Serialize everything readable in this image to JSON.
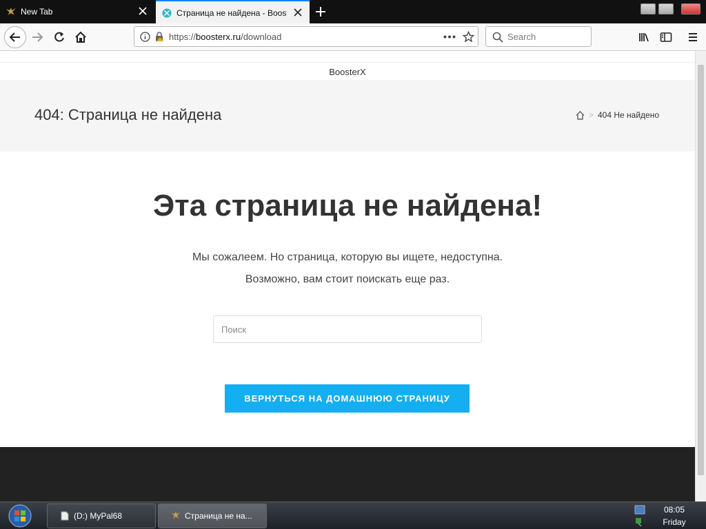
{
  "browser": {
    "tabs": [
      {
        "label": "New Tab",
        "active": false
      },
      {
        "label": "Страница не найдена - BoosterX",
        "active": true
      }
    ],
    "url": {
      "scheme": "https://",
      "host": "boosterx.ru",
      "path": "/download"
    },
    "search_placeholder": "Search"
  },
  "page": {
    "site_name": "BoosterX",
    "title": "404: Страница не найдена",
    "breadcrumb_current": "404 Не найдено",
    "heading": "Эта страница не найдена!",
    "message_line1": "Мы сожалеем. Но страница, которую вы ищете, недоступна.",
    "message_line2": "Возможно, вам стоит поискать еще раз.",
    "search_placeholder": "Поиск",
    "home_button": "ВЕРНУТЬСЯ НА ДОМАШНЮЮ СТРАНИЦУ",
    "accent_color": "#13aff0"
  },
  "taskbar": {
    "items": [
      {
        "label": "(D:) MyPal68"
      },
      {
        "label": "Страница не на..."
      }
    ],
    "clock": {
      "time": "08:05",
      "day": "Friday"
    }
  }
}
